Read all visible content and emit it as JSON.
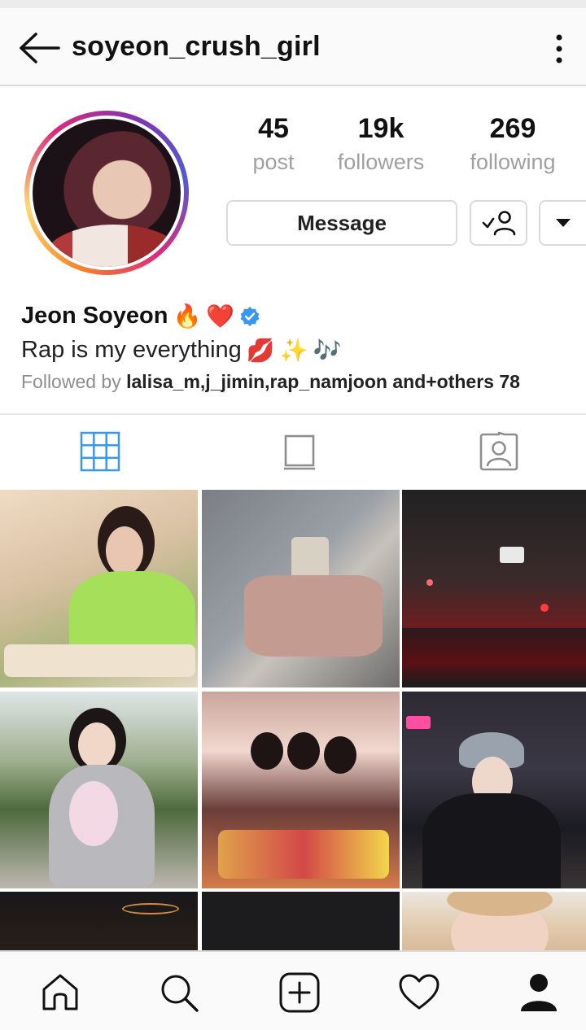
{
  "header": {
    "username": "soyeon_crush_girl",
    "back_icon": "arrow-left-icon",
    "more_icon": "more-vertical-icon"
  },
  "profile": {
    "avatar_icon": "profile-avatar",
    "stats": {
      "posts": {
        "value": "45",
        "label": "post"
      },
      "followers": {
        "value": "19k",
        "label": "followers"
      },
      "following": {
        "value": "269",
        "label": "following"
      }
    },
    "buttons": {
      "message_label": "Message",
      "follow_icon": "following-check-icon",
      "dropdown_icon": "chevron-down-icon"
    },
    "name": "Jeon Soyeon",
    "name_emojis": [
      "🔥",
      "❤️"
    ],
    "bio": "Rap is my everything",
    "bio_emojis": [
      "💋",
      "✨",
      "🎶"
    ],
    "followed_by": {
      "prefix": "Followed by",
      "names": "lalisa_m,j_jimin,rap_namjoon and+others 78"
    }
  },
  "tabs": [
    {
      "name": "grid-icon",
      "active": true
    },
    {
      "name": "igtv-icon",
      "active": false
    },
    {
      "name": "tagged-icon",
      "active": false
    }
  ],
  "colors": {
    "active_tab": "#3897f0",
    "inactive_icon": "#8e8e8e",
    "verified": "#3897f0",
    "muted_text": "#8e8e8e"
  },
  "bottom_nav": [
    {
      "name": "home-icon"
    },
    {
      "name": "search-icon"
    },
    {
      "name": "add-post-icon"
    },
    {
      "name": "heart-icon"
    },
    {
      "name": "profile-icon"
    }
  ]
}
